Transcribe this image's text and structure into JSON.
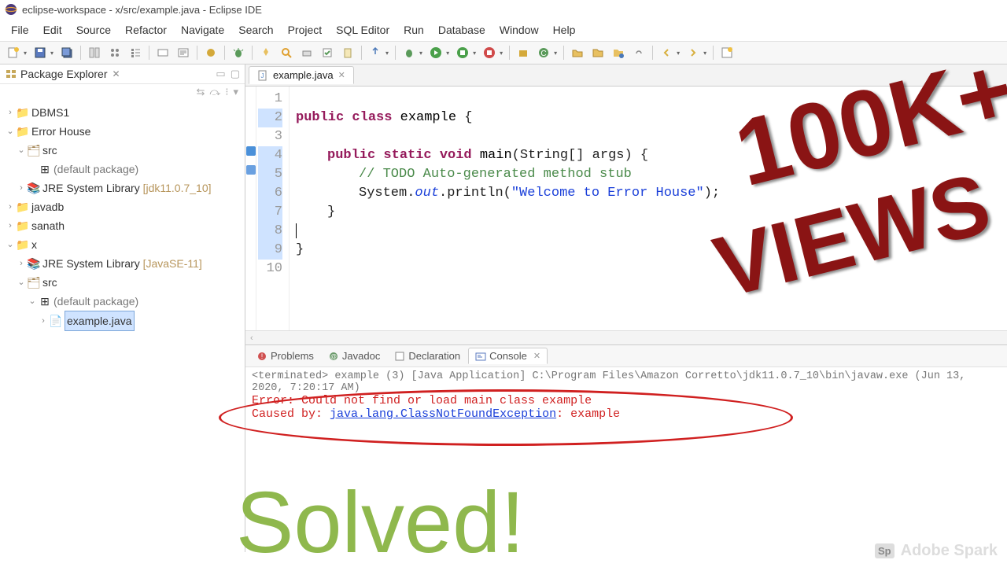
{
  "title": "eclipse-workspace - x/src/example.java - Eclipse IDE",
  "menu": [
    "File",
    "Edit",
    "Source",
    "Refactor",
    "Navigate",
    "Search",
    "Project",
    "SQL Editor",
    "Run",
    "Database",
    "Window",
    "Help"
  ],
  "pkg": {
    "title": "Package Explorer",
    "items": {
      "dbms1": "DBMS1",
      "errhouse": "Error House",
      "src1": "src",
      "defpkg1": "(default package)",
      "jre1": "JRE System Library",
      "jre1v": "[jdk11.0.7_10]",
      "javadb": "javadb",
      "sanath": "sanath",
      "x": "x",
      "jre2": "JRE System Library",
      "jre2v": "[JavaSE-11]",
      "src2": "src",
      "defpkg2": "(default package)",
      "example": "example.java"
    }
  },
  "editor": {
    "tab": "example.java",
    "lines": [
      "1",
      "2",
      "3",
      "4",
      "5",
      "6",
      "7",
      "8",
      "9",
      "10"
    ],
    "code": {
      "l2a": "public class ",
      "l2b": "example",
      "l2c": " {",
      "l4a": "public static void ",
      "l4b": "main",
      "l4c": "(String[] args) {",
      "l5": "// TODO Auto-generated method stub",
      "l6a": "System.",
      "l6b": "out",
      "l6c": ".println(",
      "l6d": "\"Welcome to Error House\"",
      "l6e": ");",
      "l7": "}",
      "l8": "",
      "l9": "}"
    }
  },
  "btabs": {
    "problems": "Problems",
    "javadoc": "Javadoc",
    "decl": "Declaration",
    "console": "Console"
  },
  "console": {
    "term": "<terminated> example (3) [Java Application] C:\\Program Files\\Amazon Corretto\\jdk11.0.7_10\\bin\\javaw.exe (Jun 13, 2020, 7:20:17 AM)",
    "err1": "Error: Could not find or load main class example",
    "err2a": "Caused by: ",
    "err2b": "java.lang.ClassNotFoundException",
    "err2c": ": example"
  },
  "overlay": {
    "stamp1": "100K+",
    "stamp2": "VIEWS",
    "solved": "Solved!",
    "wm": "Adobe Spark",
    "sp": "Sp"
  }
}
